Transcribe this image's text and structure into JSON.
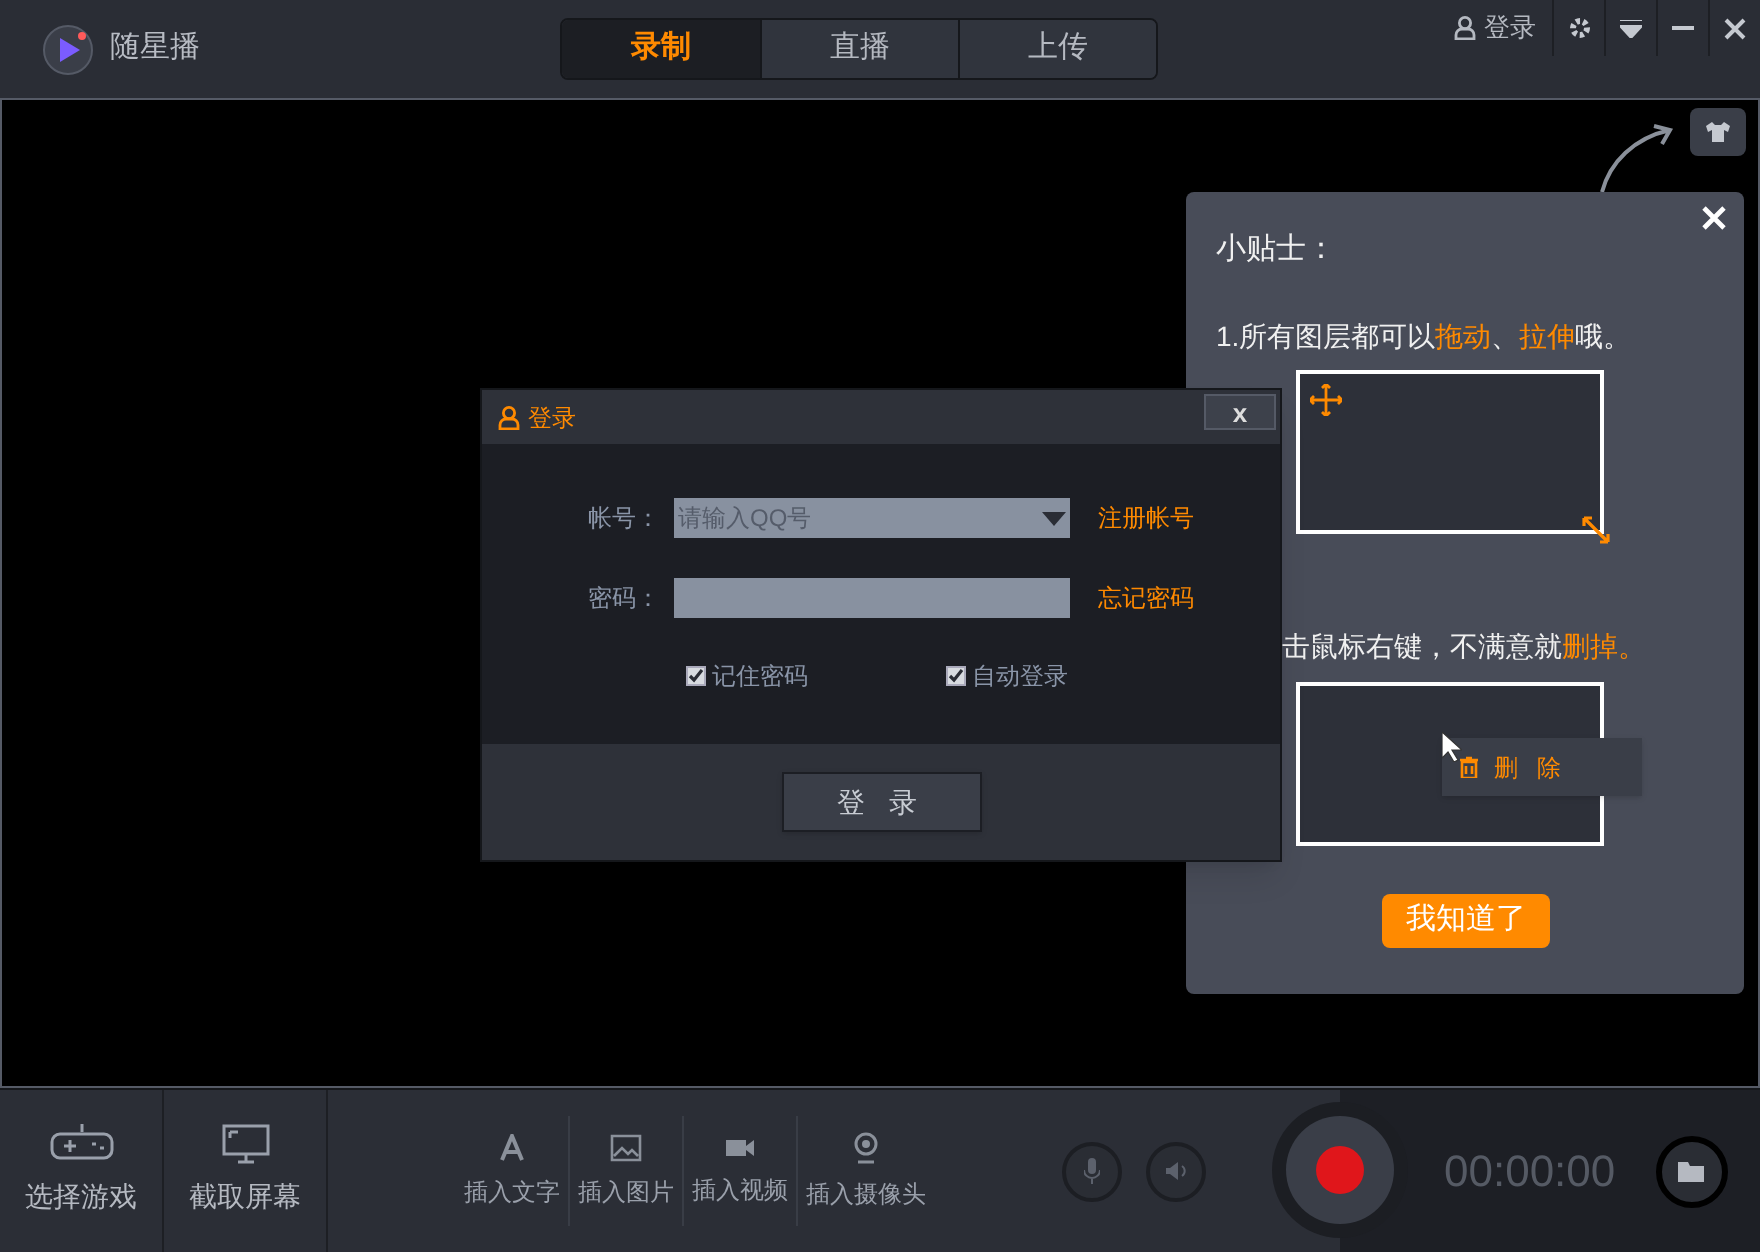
{
  "app": {
    "title": "随星播"
  },
  "tabs": [
    {
      "label": "录制",
      "selected": true
    },
    {
      "label": "直播",
      "selected": false
    },
    {
      "label": "上传",
      "selected": false
    }
  ],
  "window_controls": {
    "login": "登录"
  },
  "login_dialog": {
    "title": "登录",
    "close": "x",
    "account": {
      "label": "帐号：",
      "placeholder": "请输入QQ号",
      "link": "注册帐号"
    },
    "password": {
      "label": "密码：",
      "link": "忘记密码"
    },
    "options": [
      {
        "label": "记住密码",
        "checked": true
      },
      {
        "label": "自动登录",
        "checked": true
      }
    ],
    "submit": "登 录"
  },
  "tips": {
    "title": "小贴士：",
    "tip_1": [
      {
        "text": "1.所有图层都可以",
        "highlight": false
      },
      {
        "text": "拖动",
        "highlight": true
      },
      {
        "text": "、",
        "highlight": false
      },
      {
        "text": "拉伸",
        "highlight": true
      },
      {
        "text": "哦。",
        "highlight": false
      }
    ],
    "tip_2": [
      {
        "text": "击鼠标右键，不满意就",
        "highlight": false
      },
      {
        "text": "删掉",
        "highlight": true
      },
      {
        "text": "。",
        "highlight": true
      }
    ],
    "menu_item": "删 除",
    "confirm": "我知道了"
  },
  "bottom_bar": {
    "actions": [
      {
        "label": "选择游戏",
        "kind": "gamepad"
      },
      {
        "label": "截取屏幕",
        "kind": "monitor"
      }
    ],
    "inserts": [
      {
        "label": "插入文字",
        "kind": "text"
      },
      {
        "label": "插入图片",
        "kind": "image"
      },
      {
        "label": "插入视频",
        "kind": "video"
      },
      {
        "label": "插入摄像头",
        "kind": "camera"
      }
    ],
    "timer": "00:00:00"
  }
}
